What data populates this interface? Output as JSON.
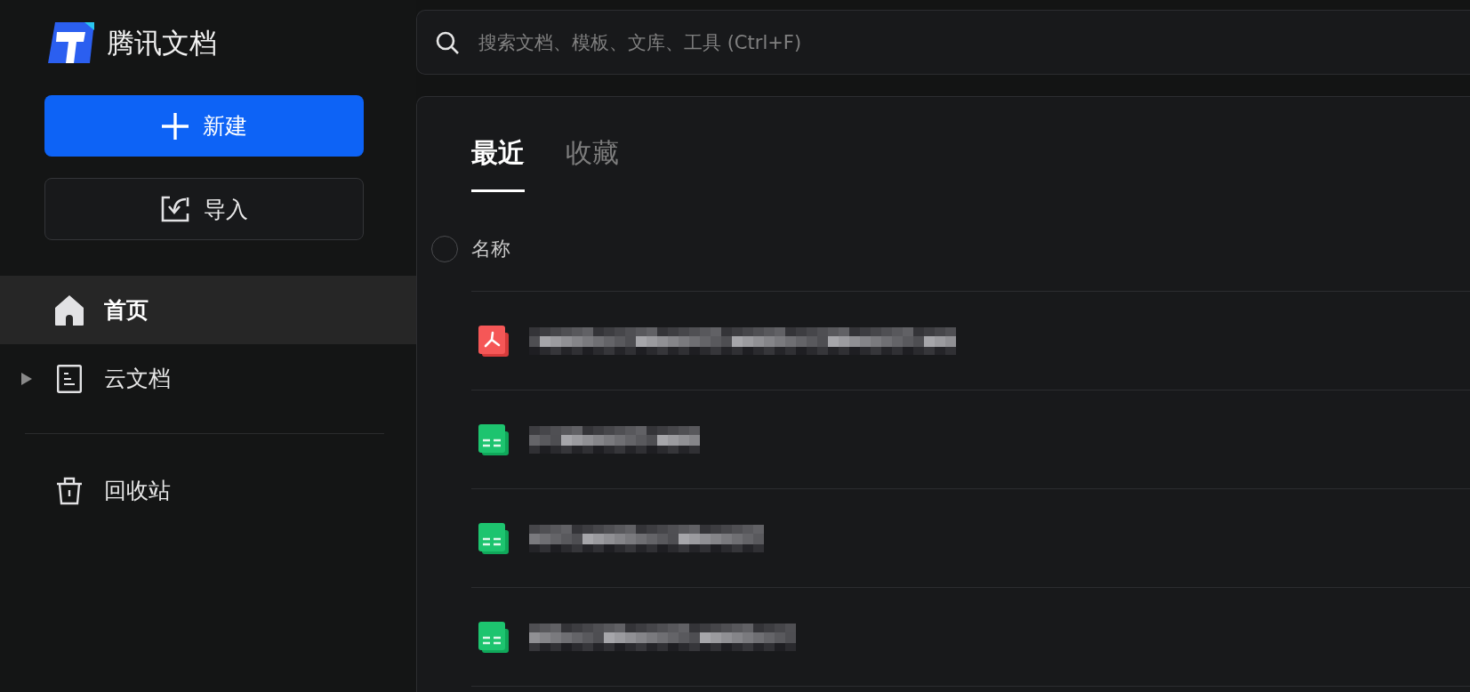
{
  "sidebar": {
    "logo": {
      "text": "腾讯文档"
    },
    "new_button": {
      "label": "新建"
    },
    "import_button": {
      "label": "导入"
    },
    "nav_items": [
      {
        "kind": "home",
        "label": "首页",
        "selected": true
      },
      {
        "kind": "document",
        "label": "云文档",
        "selected": false,
        "expanded": false
      }
    ],
    "bottom_items": [
      {
        "kind": "trash",
        "label": "回收站",
        "selected": false
      }
    ]
  },
  "search": {
    "placeholder": "搜索文档、模板、文库、工具 (Ctrl+F)"
  },
  "tabs": [
    {
      "label": "最近",
      "selected": true
    },
    {
      "label": "收藏",
      "selected": false
    }
  ],
  "file_list": {
    "select_all": {
      "checked": false
    },
    "columns": [
      {
        "label": "名称"
      }
    ],
    "rows": [
      {
        "kind": "pdf"
      },
      {
        "kind": "sheet"
      },
      {
        "kind": "sheet"
      },
      {
        "kind": "sheet"
      }
    ]
  }
}
